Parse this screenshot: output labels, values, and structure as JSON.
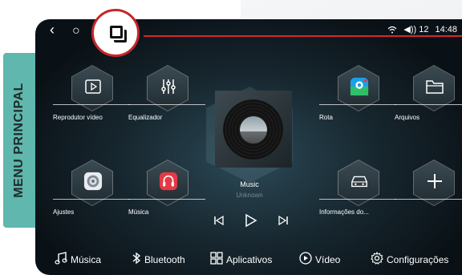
{
  "side_label": "MENU PRINCIPAL",
  "topbar": {
    "back": "‹",
    "home": "○",
    "volume": "◀)) 12",
    "time": "14:48"
  },
  "apps": [
    {
      "label": "Reprodutor vídeo",
      "icon": "video-player-icon"
    },
    {
      "label": "Equalizador",
      "icon": "equalizer-icon"
    },
    {
      "label": "Rota",
      "icon": "maps-icon"
    },
    {
      "label": "Arquivos",
      "icon": "folder-icon"
    },
    {
      "label": "Ajustes",
      "icon": "settings-icon"
    },
    {
      "label": "Música",
      "icon": "music-app-icon"
    },
    {
      "label": "Informações do...",
      "icon": "car-info-icon"
    },
    {
      "label": "",
      "icon": "add-icon"
    }
  ],
  "now_playing": {
    "title": "Music",
    "artist": "Unknown"
  },
  "controls": {
    "prev": "⏮",
    "play": "▷",
    "next": "⏭"
  },
  "dock": [
    {
      "label": "Música"
    },
    {
      "label": "Bluetooth"
    },
    {
      "label": "Aplicativos"
    },
    {
      "label": "Vídeo"
    },
    {
      "label": "Configurações"
    }
  ],
  "colors": {
    "accent_red": "#d9262b",
    "side_tab": "#5fb7ad"
  }
}
